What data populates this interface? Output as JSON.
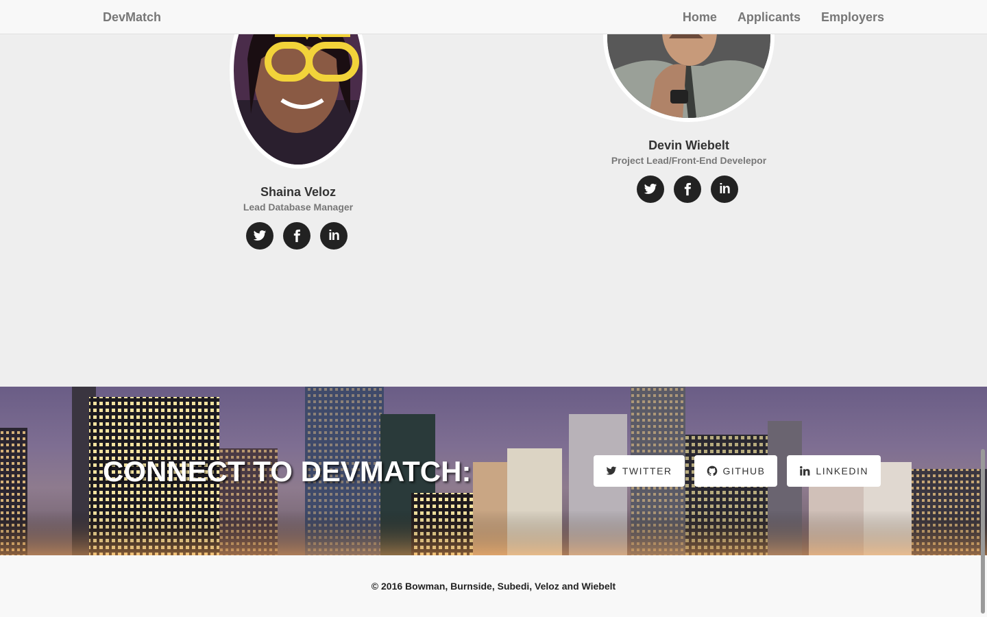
{
  "navbar": {
    "brand": "DevMatch",
    "links": [
      "Home",
      "Applicants",
      "Employers"
    ]
  },
  "team": [
    {
      "name": "Shaina Veloz",
      "role": "Lead Database Manager"
    },
    {
      "name": "Devin Wiebelt",
      "role": "Project Lead/Front-End Develepor"
    }
  ],
  "social_icons": [
    "twitter-icon",
    "facebook-icon",
    "linkedin-icon"
  ],
  "banner": {
    "title": "CONNECT TO DEVMATCH:",
    "buttons": [
      {
        "label": "TWITTER",
        "icon": "twitter-icon"
      },
      {
        "label": "GITHUB",
        "icon": "github-icon"
      },
      {
        "label": "LINKEDIN",
        "icon": "linkedin-icon"
      }
    ]
  },
  "footer": {
    "copyright": "© 2016 Bowman, Burnside, Subedi, Veloz and Wiebelt"
  },
  "colors": {
    "navbar_bg": "#f8f8f8",
    "page_bg": "#eeeeee",
    "social_circle": "#222222"
  }
}
